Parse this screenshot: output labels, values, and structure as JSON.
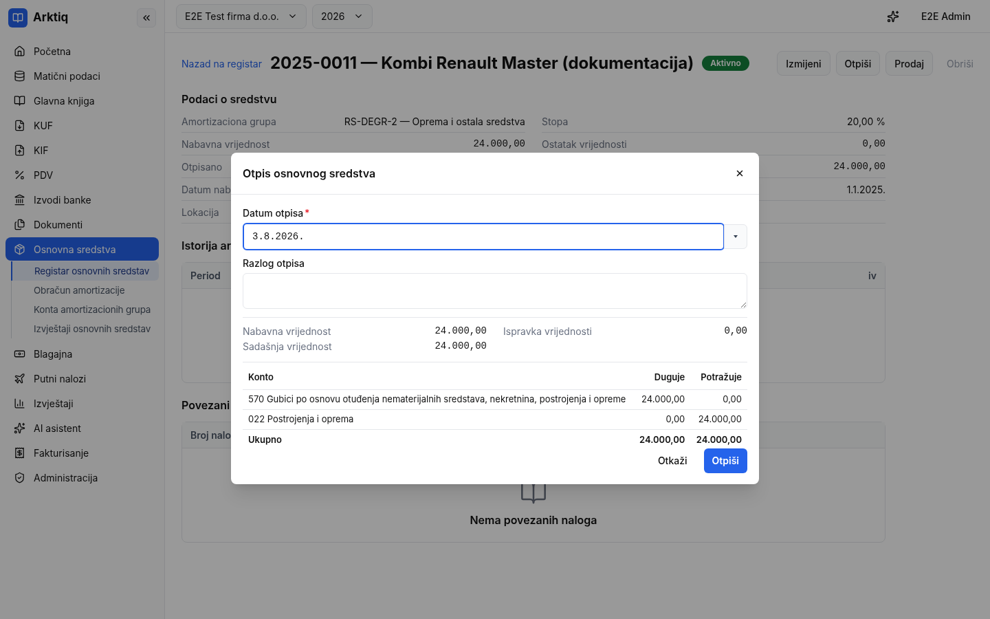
{
  "app": {
    "name": "Arktiq"
  },
  "topbar": {
    "company": "E2E Test firma d.o.o.",
    "year": "2026",
    "user": "E2E Admin"
  },
  "sidebar": {
    "items": [
      {
        "label": "Početna",
        "selected": false
      },
      {
        "label": "Matični podaci",
        "selected": false
      },
      {
        "label": "Glavna knjiga",
        "selected": false
      },
      {
        "label": "KUF",
        "selected": false
      },
      {
        "label": "KIF",
        "selected": false
      },
      {
        "label": "PDV",
        "selected": false
      },
      {
        "label": "Izvodi banke",
        "selected": false
      },
      {
        "label": "Dokumenti",
        "selected": false
      },
      {
        "label": "Osnovna sredstva",
        "selected": true,
        "children": [
          {
            "label": "Registar osnovnih sredstav",
            "selected": true
          },
          {
            "label": "Obračun amortizacije",
            "selected": false
          },
          {
            "label": "Konta amortizacionih grupa",
            "selected": false
          },
          {
            "label": "Izvještaji osnovnih sredstav",
            "selected": false
          }
        ]
      },
      {
        "label": "Blagajna",
        "selected": false
      },
      {
        "label": "Putni nalozi",
        "selected": false
      },
      {
        "label": "Izvještaji",
        "selected": false
      },
      {
        "label": "AI asistent",
        "selected": false
      },
      {
        "label": "Fakturisanje",
        "selected": false
      },
      {
        "label": "Administracija",
        "selected": false
      }
    ]
  },
  "page": {
    "back_link": "Nazad na registar",
    "title": "2025-0011 — Kombi Renault Master (dokumentacija)",
    "status": "Aktivno",
    "actions": [
      {
        "label": "Izmijeni",
        "disabled": false
      },
      {
        "label": "Otpiši",
        "disabled": false
      },
      {
        "label": "Prodaj",
        "disabled": false
      },
      {
        "label": "Obriši",
        "disabled": true
      }
    ],
    "info_title": "Podaci o sredstvu",
    "info_left": [
      {
        "label": "Amortizaciona grupa",
        "value": "RS-DEGR-2 — Oprema i ostala sredstva",
        "mono": false
      },
      {
        "label": "Nabavna vrijednost",
        "value": "24.000,00",
        "mono": true
      },
      {
        "label": "Otpisano"
      },
      {
        "label": "Datum nab"
      },
      {
        "label": "Lokacija"
      }
    ],
    "info_right": [
      {
        "label": "Stopa",
        "value": "20,00 %",
        "mono": false
      },
      {
        "label": "Ostatak vrijednosti",
        "value": "0,00",
        "mono": true
      },
      {
        "value": "24.000,00",
        "mono": true
      },
      {
        "value": "1.1.2025.",
        "mono": false
      }
    ],
    "history_title": "Istorija ar",
    "history_columns": [
      "Period",
      "iv"
    ],
    "linked_title": "Povezani",
    "linked_columns": [
      "Broj nalo"
    ],
    "linked_empty": "Nema povezanih naloga"
  },
  "dialog": {
    "title": "Otpis osnovnog sredstva",
    "date_label": "Datum otpisa",
    "required_mark": "*",
    "date_value": "3.8.2026.",
    "reason_label": "Razlog otpisa",
    "summary": [
      {
        "label": "Nabavna vrijednost",
        "value": "24.000,00"
      },
      {
        "label": "Ispravka vrijednosti",
        "value": "0,00"
      },
      {
        "label": "Sadašnja vrijednost",
        "value": "24.000,00"
      }
    ],
    "columns": [
      "Konto",
      "Duguje",
      "Potražuje"
    ],
    "rows": [
      {
        "konto": "570 Gubici po osnovu otuđenja nematerijalnih sredstava, nekretnina, postrojenja i opreme",
        "duguje": "24.000,00",
        "potrazuje": "0,00"
      },
      {
        "konto": "022 Postrojenja i oprema",
        "duguje": "0,00",
        "potrazuje": "24.000,00"
      }
    ],
    "total": {
      "konto": "Ukupno",
      "duguje": "24.000,00",
      "potrazuje": "24.000,00"
    },
    "cancel": "Otkaži",
    "confirm": "Otpiši"
  }
}
